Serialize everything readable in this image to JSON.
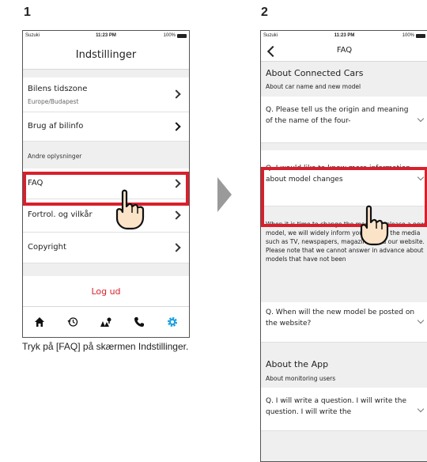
{
  "steps": {
    "one": "1",
    "two": "2"
  },
  "status_bar": {
    "carrier": "Suzuki",
    "time": "11:23 PM",
    "battery": "100%"
  },
  "screen1": {
    "title": "Indstillinger",
    "timezone_label": "Bilens tidszone",
    "timezone_value": "Europe/Budapest",
    "car_usage": "Brug af bilinfo",
    "section_other": "Andre oplysninger",
    "faq": "FAQ",
    "privacy": "Fortrol. og vilkår",
    "copyright": "Copyright",
    "logout": "Log ud",
    "tabs": [
      "home-icon",
      "history-icon",
      "map-icon",
      "phone-icon",
      "gear-icon"
    ],
    "accent_color": "#d8202c",
    "tab_active_color": "#1a9fe0"
  },
  "screen2": {
    "title": "FAQ",
    "section_connected": "About Connected Cars",
    "sub_car_name": "About car name and new model",
    "q1": "Q. Please tell us the origin and meaning of the name of the four-",
    "q2": "Q. I would like to know more information about model changes",
    "answer": "When it is time to change the model or release a new model, we will widely inform you through the media such as TV, newspapers, magazines and our website. Please note that we cannot answer in advance about models that have not been",
    "q3": "Q. When will the new model be posted on the website?",
    "section_app": "About the App",
    "sub_monitoring": "About monitoring users",
    "q4": "Q. I will write a question. I will write the question. I will write the"
  },
  "caption": "Tryk på [FAQ] på skærmen Indstillinger."
}
